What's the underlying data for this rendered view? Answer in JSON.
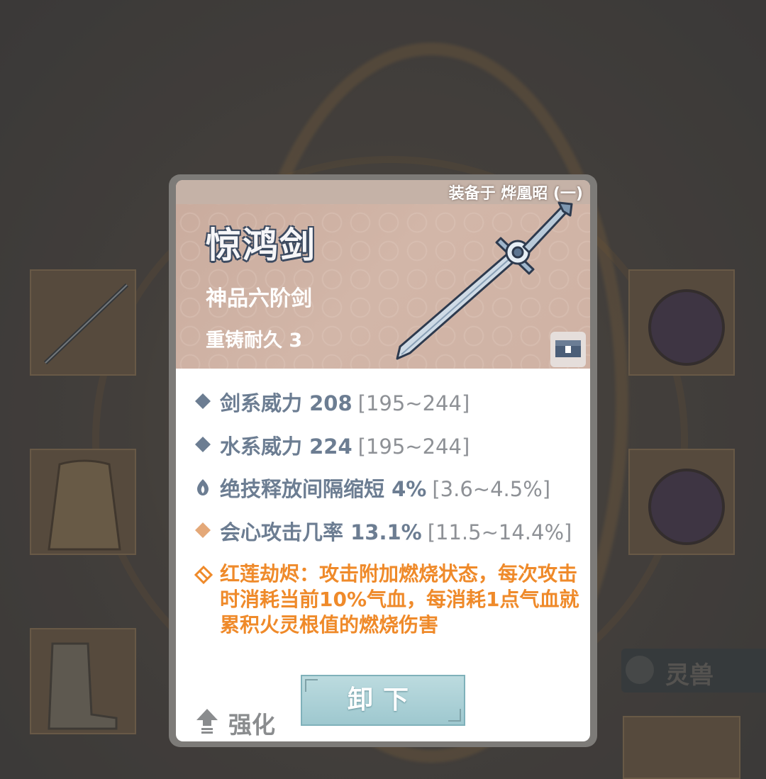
{
  "background": {
    "side_tab_label": "灵兽"
  },
  "item": {
    "equipped_to": "装备于 烨凰昭 (一)",
    "name": "惊鸿剑",
    "grade": "神品六阶剑",
    "durability": "重铸耐久 3"
  },
  "stats": [
    {
      "label": "剑系威力 208",
      "range": "[195~244]",
      "bullet": "diamond",
      "color": "#6c7d92"
    },
    {
      "label": "水系威力 224",
      "range": "[195~244]",
      "bullet": "diamond",
      "color": "#6c7d92"
    },
    {
      "label": "绝技释放间隔缩短 4%",
      "range": "[3.6~4.5%]",
      "bullet": "flame-icon",
      "color": "#6c7d92"
    },
    {
      "label": "会心攻击几率 13.1%",
      "range": "[11.5~14.4%]",
      "bullet": "diamond",
      "color": "#e4a878"
    }
  ],
  "skill": {
    "text": "红莲劫烬：攻击附加燃烧状态，每次攻击时消耗当前10%气血，每消耗1点气血就累积火灵根值的燃烧伤害",
    "color": "#ef8a2a"
  },
  "actions": {
    "enhance_label": "强化",
    "unequip_label": "卸下"
  }
}
